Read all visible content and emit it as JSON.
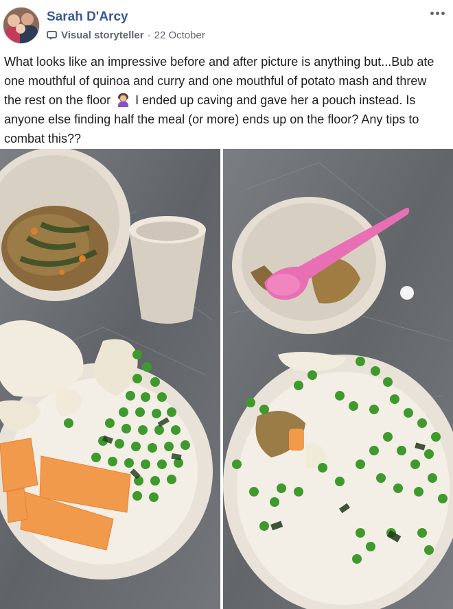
{
  "post": {
    "author_name": "Sarah D'Arcy",
    "badge_icon": "speech-bubble-icon",
    "badge_label": "Visual storyteller",
    "separator": "·",
    "date": "22 October",
    "more_icon": "more-options-icon",
    "text_part1": "What looks like an impressive before and after picture is anything but...Bub ate one mouthful of quinoa and curry and one mouthful of potato mash and threw the rest on the floor",
    "emoji": "woman-facepalming-emoji",
    "text_part2": "I ended up caving and gave her a pouch instead. Is anyone else finding half the meal (or more) ends up on the floor? Any tips to combat this??"
  },
  "colors": {
    "name_link": "#385898",
    "meta_grey": "#606770",
    "body_text": "#1c1e21",
    "counter_marble": "#6f7378",
    "plate": "#e9e2d8",
    "peas": "#3f9a2e",
    "melon": "#f29a4b",
    "spoon": "#e96fb4"
  },
  "photos": [
    {
      "name": "before-photo",
      "content": "plate-with-quinoa-curry-potato-peas-rockmelon"
    },
    {
      "name": "after-photo",
      "content": "plate-with-leftover-peas-and-pink-spoon"
    }
  ]
}
